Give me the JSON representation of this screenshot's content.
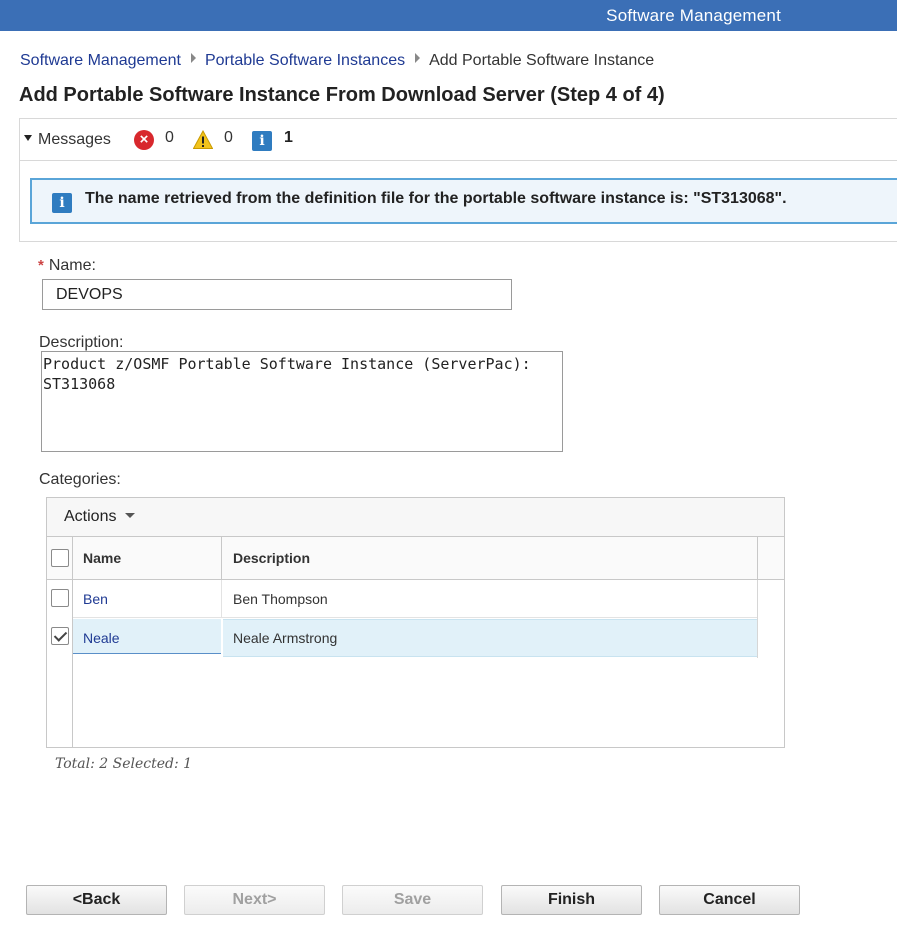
{
  "topbar": {
    "title": "Software Management"
  },
  "breadcrumb": {
    "items": [
      "Software Management",
      "Portable Software Instances"
    ],
    "current": "Add Portable Software Instance"
  },
  "page_title": "Add Portable Software Instance From Download Server (Step 4 of 4)",
  "messages": {
    "label": "Messages",
    "error_count": "0",
    "warning_count": "0",
    "info_count": "1",
    "info_text": "The name retrieved from the definition file for the portable software instance is: \"ST313068\"."
  },
  "form": {
    "name_label": "Name:",
    "name_value": "DEVOPS",
    "description_label": "Description:",
    "description_value": "Product z/OSMF Portable Software Instance (ServerPac):\nST313068",
    "categories_label": "Categories:"
  },
  "grid": {
    "actions_label": "Actions",
    "columns": [
      "Name",
      "Description"
    ],
    "rows": [
      {
        "name": "Ben",
        "description": "Ben Thompson",
        "selected": false
      },
      {
        "name": "Neale",
        "description": "Neale Armstrong",
        "selected": true
      }
    ],
    "summary": "Total: 2 Selected: 1"
  },
  "buttons": {
    "back": "<Back",
    "next": "Next>",
    "save": "Save",
    "finish": "Finish",
    "cancel": "Cancel"
  },
  "colors": {
    "topbar": "#3b6fb6",
    "link": "#1f3a93",
    "info_border": "#5aa5d8",
    "selected_row": "#e1f1f9",
    "error_icon": "#d8282d",
    "warning_icon": "#f2c31c",
    "info_icon": "#2f7cc0"
  },
  "icons": [
    "error-icon",
    "warning-icon",
    "info-icon",
    "caret-down-icon",
    "checkbox-icon"
  ]
}
